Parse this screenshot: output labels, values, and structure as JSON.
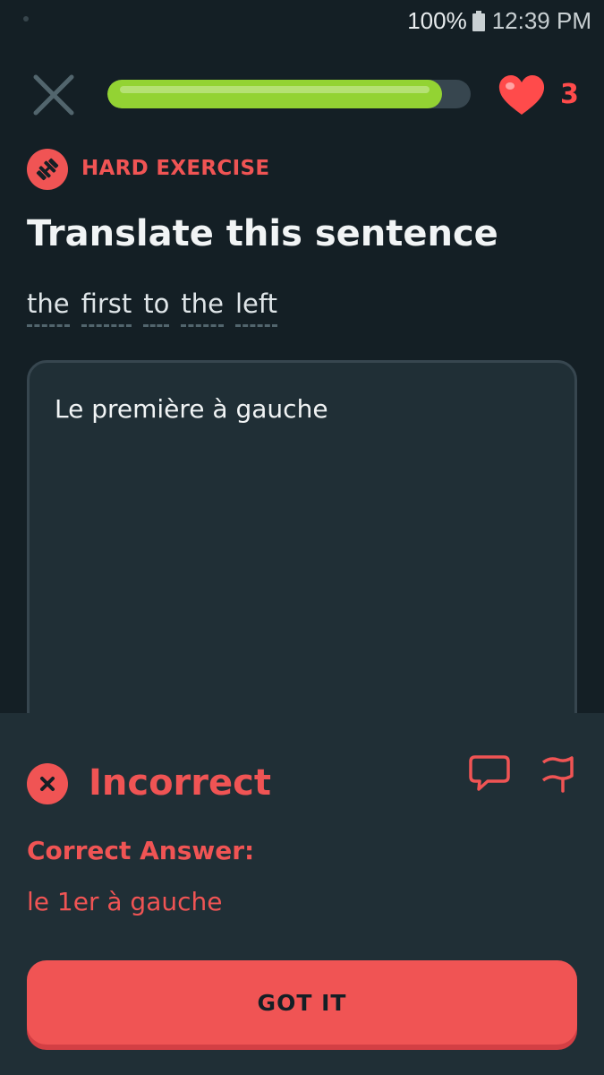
{
  "status_bar": {
    "battery": "100%",
    "time": "12:39 PM"
  },
  "lesson": {
    "progress": 0.92,
    "hearts": "3"
  },
  "exercise": {
    "badge": "HARD EXERCISE",
    "title": "Translate this sentence",
    "prompt_words": [
      "the",
      "first",
      "to",
      "the",
      "left"
    ],
    "answer": "Le première à gauche"
  },
  "feedback": {
    "title": "Incorrect",
    "correct_label": "Correct Answer:",
    "correct_value": "le 1er à gauche",
    "button": "GOT IT"
  },
  "colors": {
    "background": "#141f25",
    "panel": "#202f36",
    "error_red": "#f05454",
    "progress_green": "#93d333",
    "heart_red": "#ff4b4b"
  },
  "icons": [
    "close-icon",
    "heart-icon",
    "dumbbell-icon",
    "x-circle-icon",
    "discuss-icon",
    "flag-icon",
    "battery-icon"
  ]
}
